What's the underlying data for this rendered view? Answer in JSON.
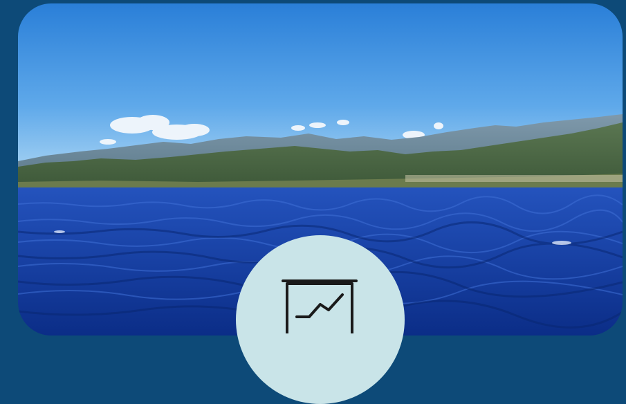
{
  "scene": {
    "subject": "sea-and-mountain-landscape",
    "colors": {
      "background": "#0d4a78",
      "sky_top": "#2e82d6",
      "sky_bottom": "#a9d3f2",
      "mountains_far": "#6f8fa3",
      "mountains_near": "#4e6d4a",
      "shore": "#6a7a4c",
      "sea_top": "#1f4fb8",
      "sea_bottom": "#0a2f8c",
      "icon_circle": "#c9e4e8",
      "icon_stroke": "#1a1a1a"
    }
  },
  "icons": {
    "presentation_chart": "presentation-chart-icon"
  }
}
